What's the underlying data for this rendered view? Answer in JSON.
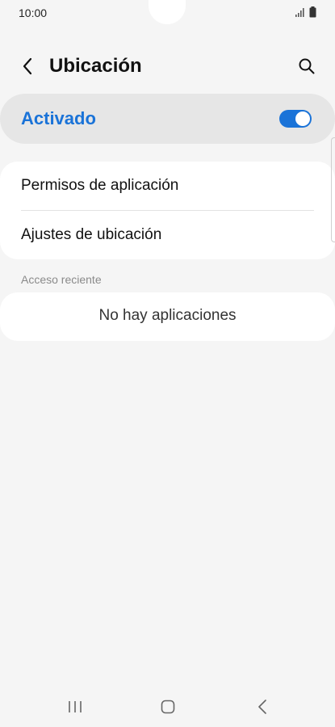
{
  "status_bar": {
    "time": "10:00",
    "icons": [
      "signal-icon",
      "battery-icon"
    ]
  },
  "header": {
    "title": "Ubicación",
    "back_icon": "chevron-left-icon",
    "search_icon": "search-icon"
  },
  "master_toggle": {
    "label": "Activado",
    "state": true,
    "accent_color": "#1a73d8"
  },
  "options": [
    {
      "label": "Permisos de aplicación"
    },
    {
      "label": "Ajustes de ubicación"
    }
  ],
  "recent_access": {
    "section_title": "Acceso reciente",
    "empty_text": "No hay aplicaciones"
  },
  "nav_bar": {
    "buttons": [
      "recents-icon",
      "home-icon",
      "back-icon"
    ]
  }
}
